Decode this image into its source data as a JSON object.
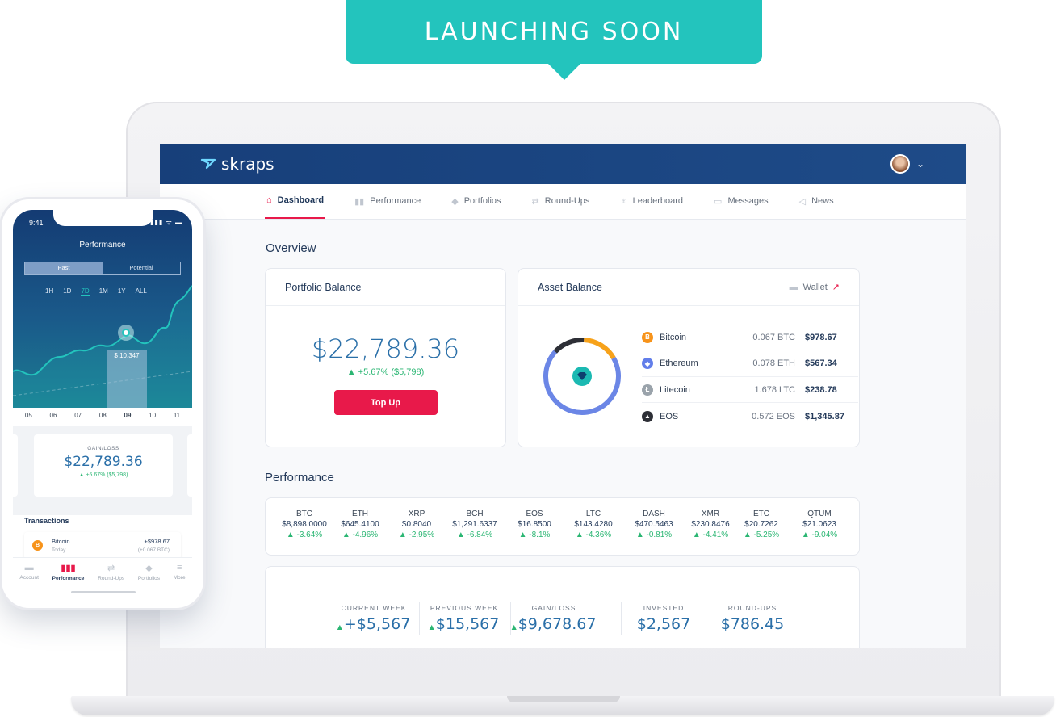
{
  "banner": {
    "text": "LAUNCHING SOON"
  },
  "app": {
    "logo_text": "skraps"
  },
  "nav": [
    {
      "label": "Dashboard",
      "icon": "home-icon",
      "active": true
    },
    {
      "label": "Performance",
      "icon": "bars-icon"
    },
    {
      "label": "Portfolios",
      "icon": "gem-icon"
    },
    {
      "label": "Round-Ups",
      "icon": "swap-icon"
    },
    {
      "label": "Leaderboard",
      "icon": "trophy-icon"
    },
    {
      "label": "Messages",
      "icon": "chat-icon"
    },
    {
      "label": "News",
      "icon": "megaphone-icon"
    }
  ],
  "overview": {
    "title": "Overview",
    "portfolio": {
      "title": "Portfolio Balance",
      "amount": "$22,789.36",
      "change": "▲ +5.67% ($5,798)",
      "button": "Top Up"
    },
    "assets": {
      "title": "Asset Balance",
      "wallet_label": "Wallet",
      "donut_share": [
        0.7,
        0.14,
        0.16
      ],
      "rows": [
        {
          "name": "Bitcoin",
          "qty": "0.067 BTC",
          "usd": "$978.67",
          "color": "#f7931a",
          "glyph": "B"
        },
        {
          "name": "Ethereum",
          "qty": "0.078 ETH",
          "usd": "$567.34",
          "color": "#627eea",
          "glyph": "◆"
        },
        {
          "name": "Litecoin",
          "qty": "1.678 LTC",
          "usd": "$238.78",
          "color": "#9aa3ab",
          "glyph": "Ł"
        },
        {
          "name": "EOS",
          "qty": "0.572 EOS",
          "usd": "$1,345.87",
          "color": "#2d2f36",
          "glyph": "▲"
        }
      ]
    }
  },
  "performance": {
    "title": "Performance",
    "tickers": [
      {
        "sym": "BTC",
        "price": "$8,898.0000",
        "change": "▲ -3.64%"
      },
      {
        "sym": "ETH",
        "price": "$645.4100",
        "change": "▲ -4.96%"
      },
      {
        "sym": "XRP",
        "price": "$0.8040",
        "change": "▲ -2.95%"
      },
      {
        "sym": "BCH",
        "price": "$1,291.6337",
        "change": "▲ -6.84%"
      },
      {
        "sym": "EOS",
        "price": "$16.8500",
        "change": "▲ -8.1%"
      },
      {
        "sym": "LTC",
        "price": "$143.4280",
        "change": "▲ -4.36%"
      },
      {
        "sym": "DASH",
        "price": "$470.5463",
        "change": "▲ -0.81%"
      },
      {
        "sym": "XMR",
        "price": "$230.8476",
        "change": "▲ -4.41%"
      },
      {
        "sym": "ETC",
        "price": "$20.7262",
        "change": "▲ -5.25%"
      },
      {
        "sym": "QTUM",
        "price": "$21.0623",
        "change": "▲ -9.04%"
      }
    ],
    "stats": [
      {
        "label": "CURRENT WEEK",
        "value": "+$5,567",
        "arrow": "▲"
      },
      {
        "label": "PREVIOUS WEEK",
        "value": "$15,567",
        "arrow": "▲"
      },
      {
        "label": "GAIN/LOSS",
        "value": "$9,678.67",
        "arrow": "▲"
      },
      {
        "label": "INVESTED",
        "value": "$2,567",
        "arrow": ""
      },
      {
        "label": "ROUND-UPS",
        "value": "$786.45",
        "arrow": ""
      }
    ]
  },
  "phone": {
    "time": "9:41",
    "status": "▮▮▮ ᯤ ▬",
    "title": "Performance",
    "segments": [
      "Past",
      "Potential"
    ],
    "ranges": [
      "1H",
      "1D",
      "7D",
      "1M",
      "1Y",
      "ALL"
    ],
    "active_range": "7D",
    "tooltip": "$ 10,347",
    "days": [
      "05",
      "06",
      "07",
      "08",
      "09",
      "10",
      "11"
    ],
    "gain_label": "GAIN/LOSS",
    "gain_value": "$22,789.36",
    "gain_change": "▲ +5.67% ($5,798)",
    "tx_title": "Transactions",
    "tx": {
      "name": "Bitcoin",
      "sub": "Today",
      "amount": "+$978.67",
      "amount_sub": "(+0.067 BTC)"
    },
    "tabs": [
      {
        "label": "Account",
        "icon": "wallet-icon"
      },
      {
        "label": "Performance",
        "icon": "bars-icon",
        "active": true
      },
      {
        "label": "Round-Ups",
        "icon": "swap-icon"
      },
      {
        "label": "Portfolios",
        "icon": "gem-icon"
      },
      {
        "label": "More",
        "icon": "menu-icon"
      }
    ]
  }
}
